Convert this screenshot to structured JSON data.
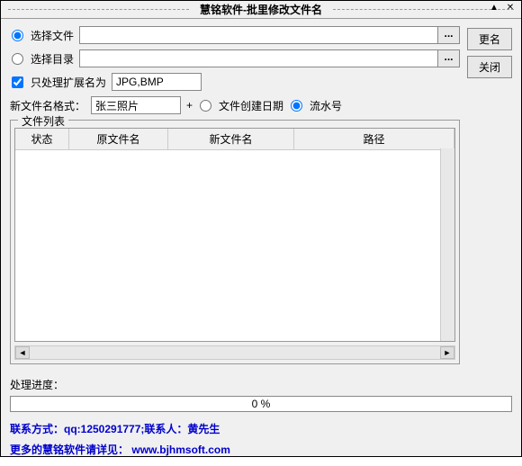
{
  "window": {
    "title": "慧铭软件-批里修改文件名"
  },
  "buttons": {
    "rename": "更名",
    "close": "关闭",
    "browse": "..."
  },
  "mode": {
    "select_file": "选择文件",
    "select_dir": "选择目录",
    "file_value": "",
    "dir_value": ""
  },
  "ext": {
    "label": "只处理扩展名为",
    "value": "JPG,BMP"
  },
  "format": {
    "label": "新文件名格式：",
    "value": "张三照片",
    "plus": "+",
    "opt_date": "文件创建日期",
    "opt_serial": "流水号"
  },
  "table": {
    "legend": "文件列表",
    "headers": {
      "status": "状态",
      "orig": "原文件名",
      "new": "新文件名",
      "path": "路径"
    }
  },
  "progress": {
    "label": "处理进度：",
    "text": "0 %"
  },
  "footer": {
    "contact": "联系方式：qq:1250291777;联系人：黄先生",
    "more_prefix": "更多的慧铭软件请详见：",
    "url": "www.bjhmsoft.com"
  }
}
